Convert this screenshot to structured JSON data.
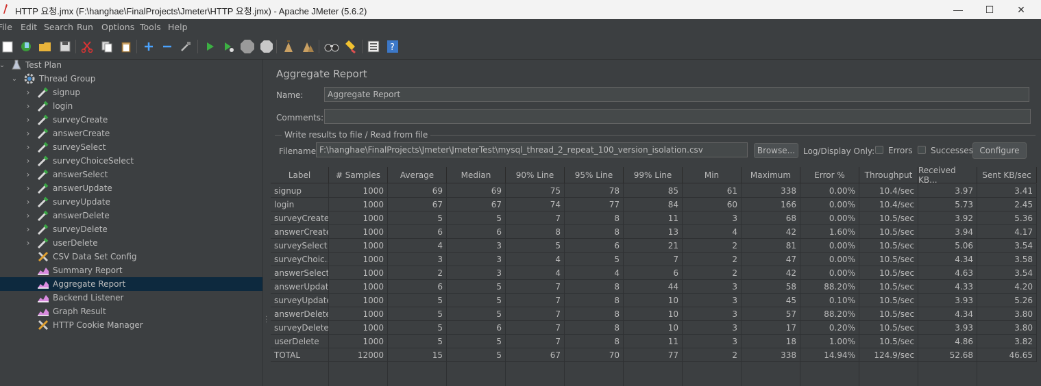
{
  "window": {
    "title": "HTTP 요청.jmx (F:\\hanghae\\FinalProjects\\Jmeter\\HTTP 요청.jmx) - Apache JMeter (5.6.2)",
    "minimize_glyph": "—",
    "maximize_glyph": "☐",
    "close_glyph": "✕"
  },
  "menu": [
    "File",
    "Edit",
    "Search",
    "Run",
    "Options",
    "Tools",
    "Help"
  ],
  "toolbar_icons": [
    "new-icon",
    "templates-icon",
    "open-icon",
    "save-icon",
    "cut-icon",
    "copy-icon",
    "paste-icon",
    "expand-icon",
    "collapse-icon",
    "toggle-icon",
    "start-icon",
    "start-no-pause-icon",
    "stop-icon",
    "shutdown-icon",
    "clear-icon",
    "clear-all-icon",
    "search-icon",
    "reset-search-icon",
    "function-helper-icon",
    "help-icon"
  ],
  "tree": {
    "root": "Test Plan",
    "group": "Thread Group",
    "samplers": [
      "signup",
      "login",
      "surveyCreate",
      "answerCreate",
      "surveySelect",
      "surveyChoiceSelect",
      "answerSelect",
      "answerUpdate",
      "surveyUpdate",
      "answerDelete",
      "surveyDelete",
      "userDelete"
    ],
    "elements": [
      {
        "label": "CSV Data Set Config",
        "icon": "csv-config-icon"
      },
      {
        "label": "Summary Report",
        "icon": "listener-icon"
      },
      {
        "label": "Aggregate Report",
        "icon": "listener-icon",
        "selected": true
      },
      {
        "label": "Backend Listener",
        "icon": "listener-icon"
      },
      {
        "label": "Graph Result",
        "icon": "listener-icon"
      },
      {
        "label": "HTTP Cookie Manager",
        "icon": "config-icon"
      }
    ]
  },
  "panel": {
    "title": "Aggregate Report",
    "name_label": "Name:",
    "name_value": "Aggregate Report",
    "comments_label": "Comments:",
    "comments_value": "",
    "group_title": "Write results to file / Read from file",
    "filename_label": "Filename",
    "filename_value": "F:\\hanghae\\FinalProjects\\Jmeter\\JmeterTest\\mysql_thread_2_repeat_100_version_isolation.csv",
    "browse_label": "Browse...",
    "log_display_label": "Log/Display Only:",
    "errors_label": "Errors",
    "successes_label": "Successes",
    "configure_label": "Configure"
  },
  "table": {
    "headers": [
      "Label",
      "# Samples",
      "Average",
      "Median",
      "90% Line",
      "95% Line",
      "99% Line",
      "Min",
      "Maximum",
      "Error %",
      "Throughput",
      "Received KB...",
      "Sent KB/sec"
    ],
    "rows": [
      [
        "signup",
        "1000",
        "69",
        "69",
        "75",
        "78",
        "85",
        "61",
        "338",
        "0.00%",
        "10.4/sec",
        "3.97",
        "3.41"
      ],
      [
        "login",
        "1000",
        "67",
        "67",
        "74",
        "77",
        "84",
        "60",
        "166",
        "0.00%",
        "10.4/sec",
        "5.73",
        "2.45"
      ],
      [
        "surveyCreate",
        "1000",
        "5",
        "5",
        "7",
        "8",
        "11",
        "3",
        "68",
        "0.00%",
        "10.5/sec",
        "3.92",
        "5.36"
      ],
      [
        "answerCreate",
        "1000",
        "6",
        "6",
        "8",
        "8",
        "13",
        "4",
        "42",
        "1.60%",
        "10.5/sec",
        "3.94",
        "4.17"
      ],
      [
        "surveySelect",
        "1000",
        "4",
        "3",
        "5",
        "6",
        "21",
        "2",
        "81",
        "0.00%",
        "10.5/sec",
        "5.06",
        "3.54"
      ],
      [
        "surveyChoic...",
        "1000",
        "3",
        "3",
        "4",
        "5",
        "7",
        "2",
        "47",
        "0.00%",
        "10.5/sec",
        "4.34",
        "3.58"
      ],
      [
        "answerSelect",
        "1000",
        "2",
        "3",
        "4",
        "4",
        "6",
        "2",
        "42",
        "0.00%",
        "10.5/sec",
        "4.63",
        "3.54"
      ],
      [
        "answerUpdate",
        "1000",
        "6",
        "5",
        "7",
        "8",
        "44",
        "3",
        "58",
        "88.20%",
        "10.5/sec",
        "4.33",
        "4.20"
      ],
      [
        "surveyUpdate",
        "1000",
        "5",
        "5",
        "7",
        "8",
        "10",
        "3",
        "45",
        "0.10%",
        "10.5/sec",
        "3.93",
        "5.26"
      ],
      [
        "answerDelete",
        "1000",
        "5",
        "5",
        "7",
        "8",
        "10",
        "3",
        "57",
        "88.20%",
        "10.5/sec",
        "4.34",
        "3.80"
      ],
      [
        "surveyDelete",
        "1000",
        "5",
        "6",
        "7",
        "8",
        "10",
        "3",
        "17",
        "0.20%",
        "10.5/sec",
        "3.93",
        "3.80"
      ],
      [
        "userDelete",
        "1000",
        "5",
        "5",
        "7",
        "8",
        "11",
        "3",
        "18",
        "1.00%",
        "10.5/sec",
        "4.86",
        "3.82"
      ],
      [
        "TOTAL",
        "12000",
        "15",
        "5",
        "67",
        "70",
        "77",
        "2",
        "338",
        "14.94%",
        "124.9/sec",
        "52.68",
        "46.65"
      ]
    ]
  }
}
